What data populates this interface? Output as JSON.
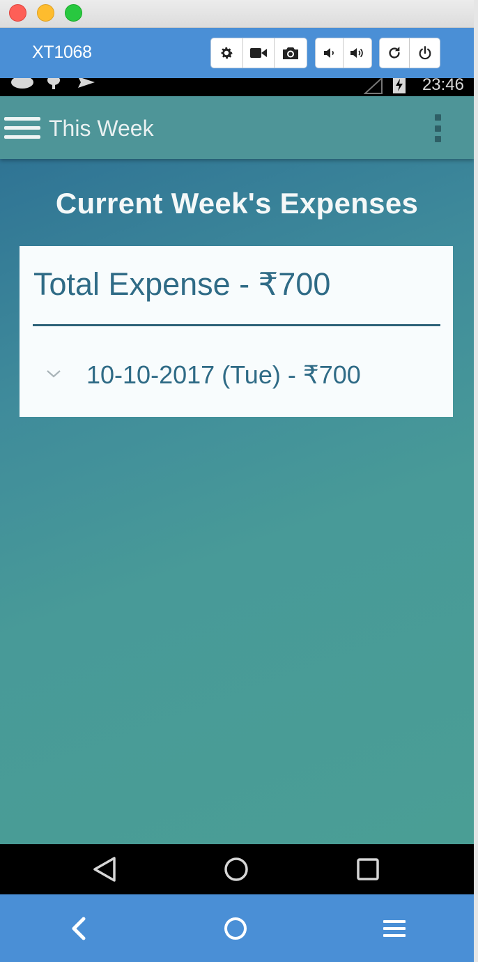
{
  "window": {
    "traffic_lights": [
      "close",
      "minimize",
      "maximize"
    ]
  },
  "device_toolbar": {
    "device_name": "XT1068",
    "groups": [
      [
        "gear-icon",
        "video-camera-icon",
        "camera-icon"
      ],
      [
        "volume-down-icon",
        "volume-up-icon"
      ],
      [
        "rotate-icon",
        "power-icon"
      ]
    ]
  },
  "status_bar": {
    "time": "23:46"
  },
  "app_bar": {
    "title": "This Week",
    "menu_icon": "hamburger-icon",
    "overflow_icon": "more-vertical-icon"
  },
  "main": {
    "heading": "Current Week's Expenses",
    "card": {
      "total": "Total Expense - ₹700",
      "entries": [
        {
          "label": "10-10-2017 (Tue) - ₹700",
          "icon": "chevron-down-icon"
        }
      ]
    }
  },
  "android_nav": {
    "items": [
      "back-triangle-icon",
      "home-circle-icon",
      "recents-square-icon"
    ]
  },
  "bottom_bar": {
    "items": [
      "back-chevron-icon",
      "home-circle-icon",
      "menu-icon"
    ]
  },
  "colors": {
    "toolbar_blue": "#4a8fd6",
    "app_bar_teal": "#4e9598",
    "text_blue": "#2f6b86"
  }
}
